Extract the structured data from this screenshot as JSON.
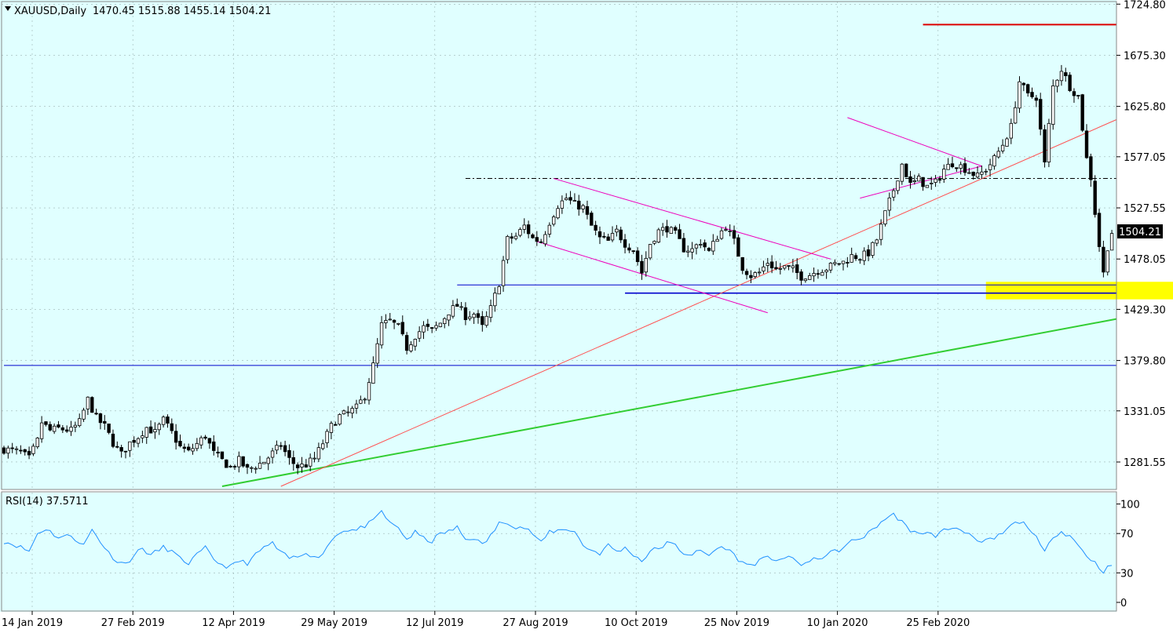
{
  "header": {
    "symbol": "XAUUSD,Daily",
    "ohlc": "1470.45 1515.88 1455.14 1504.21"
  },
  "rsi": {
    "label": "RSI(14) 37.5711"
  },
  "colors": {
    "background": "#e0ffff",
    "grid": "#9cb4b4",
    "candle_up": "#ffffff",
    "candle_down": "#000000",
    "support": "#0000cc",
    "trendline_green": "#32cd32",
    "trendline_red": "#ff5050",
    "resistance": "#dd0000",
    "pattern": "#ee00bb",
    "rsi_line": "#1e90ff",
    "highlight": "#ffff00"
  },
  "chart_data": [
    {
      "type": "candlestick",
      "title": "XAUUSD,Daily",
      "last_price": "1504.21",
      "ylim": [
        1258,
        1725
      ],
      "y_ticks": [
        "1724.80",
        "1675.30",
        "1625.80",
        "1577.05",
        "1527.55",
        "1478.05",
        "1429.30",
        "1379.80",
        "1331.05",
        "1281.55"
      ],
      "x_ticks": [
        "14 Jan 2019",
        "27 Feb 2019",
        "12 Apr 2019",
        "29 May 2019",
        "12 Jul 2019",
        "27 Aug 2019",
        "10 Oct 2019",
        "25 Nov 2019",
        "10 Jan 2020",
        "25 Feb 2020"
      ],
      "close_path": [
        [
          0,
          1294
        ],
        [
          4,
          1291
        ],
        [
          6,
          1285
        ],
        [
          8,
          1302
        ],
        [
          9,
          1320
        ],
        [
          11,
          1312
        ],
        [
          13,
          1314
        ],
        [
          16,
          1312
        ],
        [
          18,
          1320
        ],
        [
          20,
          1342
        ],
        [
          22,
          1324
        ],
        [
          24,
          1316
        ],
        [
          26,
          1300
        ],
        [
          28,
          1289
        ],
        [
          30,
          1300
        ],
        [
          32,
          1306
        ],
        [
          34,
          1315
        ],
        [
          36,
          1310
        ],
        [
          38,
          1322
        ],
        [
          40,
          1310
        ],
        [
          42,
          1296
        ],
        [
          44,
          1291
        ],
        [
          46,
          1299
        ],
        [
          48,
          1307
        ],
        [
          50,
          1290
        ],
        [
          52,
          1283
        ],
        [
          54,
          1276
        ],
        [
          56,
          1283
        ],
        [
          58,
          1274
        ],
        [
          60,
          1278
        ],
        [
          62,
          1282
        ],
        [
          64,
          1290
        ],
        [
          66,
          1298
        ],
        [
          68,
          1284
        ],
        [
          70,
          1277
        ],
        [
          72,
          1279
        ],
        [
          74,
          1285
        ],
        [
          76,
          1300
        ],
        [
          78,
          1316
        ],
        [
          80,
          1326
        ],
        [
          82,
          1329
        ],
        [
          84,
          1334
        ],
        [
          86,
          1346
        ],
        [
          88,
          1375
        ],
        [
          90,
          1414
        ],
        [
          92,
          1418
        ],
        [
          94,
          1412
        ],
        [
          96,
          1392
        ],
        [
          98,
          1404
        ],
        [
          100,
          1412
        ],
        [
          102,
          1409
        ],
        [
          104,
          1416
        ],
        [
          106,
          1427
        ],
        [
          108,
          1433
        ],
        [
          110,
          1423
        ],
        [
          112,
          1425
        ],
        [
          114,
          1412
        ],
        [
          116,
          1430
        ],
        [
          118,
          1455
        ],
        [
          120,
          1497
        ],
        [
          122,
          1500
        ],
        [
          124,
          1510
        ],
        [
          126,
          1498
        ],
        [
          128,
          1495
        ],
        [
          130,
          1514
        ],
        [
          132,
          1530
        ],
        [
          134,
          1537
        ],
        [
          136,
          1531
        ],
        [
          138,
          1528
        ],
        [
          140,
          1510
        ],
        [
          142,
          1498
        ],
        [
          144,
          1495
        ],
        [
          146,
          1505
        ],
        [
          148,
          1493
        ],
        [
          150,
          1487
        ],
        [
          152,
          1465
        ],
        [
          154,
          1493
        ],
        [
          156,
          1505
        ],
        [
          158,
          1508
        ],
        [
          160,
          1502
        ],
        [
          162,
          1488
        ],
        [
          164,
          1487
        ],
        [
          166,
          1495
        ],
        [
          168,
          1485
        ],
        [
          170,
          1500
        ],
        [
          172,
          1510
        ],
        [
          174,
          1495
        ],
        [
          176,
          1470
        ],
        [
          178,
          1462
        ],
        [
          180,
          1465
        ],
        [
          182,
          1475
        ],
        [
          184,
          1468
        ],
        [
          186,
          1470
        ],
        [
          188,
          1468
        ],
        [
          190,
          1461
        ],
        [
          192,
          1463
        ],
        [
          194,
          1467
        ],
        [
          196,
          1469
        ],
        [
          198,
          1473
        ],
        [
          200,
          1475
        ],
        [
          202,
          1481
        ],
        [
          204,
          1480
        ],
        [
          206,
          1484
        ],
        [
          208,
          1497
        ],
        [
          210,
          1522
        ],
        [
          212,
          1545
        ],
        [
          214,
          1570
        ],
        [
          216,
          1550
        ],
        [
          218,
          1555
        ],
        [
          220,
          1548
        ],
        [
          222,
          1552
        ],
        [
          224,
          1565
        ],
        [
          226,
          1571
        ],
        [
          228,
          1568
        ],
        [
          230,
          1563
        ],
        [
          232,
          1558
        ],
        [
          234,
          1565
        ],
        [
          236,
          1575
        ],
        [
          238,
          1589
        ],
        [
          240,
          1606
        ],
        [
          242,
          1650
        ],
        [
          244,
          1636
        ],
        [
          246,
          1635
        ],
        [
          248,
          1570
        ],
        [
          250,
          1645
        ],
        [
          252,
          1662
        ],
        [
          254,
          1645
        ],
        [
          256,
          1635
        ],
        [
          258,
          1575
        ],
        [
          259,
          1557
        ],
        [
          260,
          1523
        ],
        [
          261,
          1491
        ],
        [
          262,
          1464
        ],
        [
          263,
          1490
        ],
        [
          264,
          1504
        ]
      ],
      "overlays": [
        {
          "name": "support-1453",
          "kind": "horizontal",
          "price": 1453,
          "from": 108,
          "to": 280
        },
        {
          "name": "support-1445",
          "kind": "horizontal",
          "price": 1445,
          "from": 148,
          "to": 280
        },
        {
          "name": "support-1375",
          "kind": "horizontal",
          "price": 1375,
          "from": 0,
          "to": 280
        },
        {
          "name": "resistance-1705",
          "kind": "horizontal",
          "price": 1705,
          "from": 219,
          "to": 280
        },
        {
          "name": "neckline-1556",
          "kind": "horizontal-dashed",
          "price": 1556,
          "from": 110,
          "to": 280
        },
        {
          "name": "green-trendline",
          "kind": "trend",
          "points": [
            [
              52,
              1258
            ],
            [
              280,
              1420
            ]
          ]
        },
        {
          "name": "red-trendline",
          "kind": "trend",
          "points": [
            [
              66,
              1258
            ],
            [
              280,
              1613
            ]
          ]
        },
        {
          "name": "channel-upper",
          "kind": "pattern",
          "points": [
            [
              131,
              1556
            ],
            [
              197,
              1478
            ]
          ]
        },
        {
          "name": "channel-lower",
          "kind": "pattern",
          "points": [
            [
              127,
              1495
            ],
            [
              182,
              1426
            ]
          ]
        },
        {
          "name": "triangle-upper",
          "kind": "pattern",
          "points": [
            [
              201,
              1615
            ],
            [
              233,
              1568
            ]
          ]
        },
        {
          "name": "triangle-lower",
          "kind": "pattern",
          "points": [
            [
              204,
              1537
            ],
            [
              233,
              1568
            ]
          ]
        },
        {
          "name": "support-zone",
          "kind": "zone",
          "from": 234,
          "to": 279,
          "price_top": 1456,
          "price_bottom": 1439
        }
      ]
    },
    {
      "type": "line",
      "title": "RSI(14) 37.5711",
      "ylim": [
        -8,
        110
      ],
      "y_ticks": [
        "100",
        "70",
        "30",
        "0"
      ],
      "levels": [
        70,
        30
      ],
      "path": [
        [
          0,
          62
        ],
        [
          3,
          58
        ],
        [
          6,
          52
        ],
        [
          8,
          70
        ],
        [
          10,
          75
        ],
        [
          13,
          66
        ],
        [
          16,
          68
        ],
        [
          19,
          58
        ],
        [
          21,
          74
        ],
        [
          23,
          62
        ],
        [
          25,
          50
        ],
        [
          27,
          42
        ],
        [
          29,
          39
        ],
        [
          31,
          48
        ],
        [
          33,
          55
        ],
        [
          35,
          48
        ],
        [
          38,
          56
        ],
        [
          40,
          52
        ],
        [
          42,
          44
        ],
        [
          44,
          40
        ],
        [
          46,
          48
        ],
        [
          48,
          55
        ],
        [
          50,
          44
        ],
        [
          52,
          38
        ],
        [
          54,
          36
        ],
        [
          56,
          42
        ],
        [
          58,
          40
        ],
        [
          60,
          48
        ],
        [
          62,
          56
        ],
        [
          64,
          60
        ],
        [
          66,
          50
        ],
        [
          68,
          45
        ],
        [
          70,
          46
        ],
        [
          72,
          52
        ],
        [
          74,
          45
        ],
        [
          76,
          50
        ],
        [
          78,
          63
        ],
        [
          80,
          72
        ],
        [
          82,
          74
        ],
        [
          84,
          73
        ],
        [
          86,
          78
        ],
        [
          88,
          82
        ],
        [
          90,
          93
        ],
        [
          92,
          80
        ],
        [
          94,
          76
        ],
        [
          96,
          64
        ],
        [
          98,
          71
        ],
        [
          100,
          65
        ],
        [
          102,
          62
        ],
        [
          104,
          70
        ],
        [
          106,
          72
        ],
        [
          108,
          76
        ],
        [
          110,
          64
        ],
        [
          112,
          66
        ],
        [
          114,
          58
        ],
        [
          116,
          68
        ],
        [
          118,
          80
        ],
        [
          120,
          82
        ],
        [
          122,
          77
        ],
        [
          124,
          76
        ],
        [
          126,
          70
        ],
        [
          128,
          60
        ],
        [
          130,
          72
        ],
        [
          132,
          73
        ],
        [
          134,
          75
        ],
        [
          136,
          72
        ],
        [
          138,
          58
        ],
        [
          140,
          53
        ],
        [
          142,
          50
        ],
        [
          144,
          58
        ],
        [
          146,
          52
        ],
        [
          148,
          55
        ],
        [
          150,
          49
        ],
        [
          152,
          42
        ],
        [
          154,
          52
        ],
        [
          156,
          55
        ],
        [
          158,
          60
        ],
        [
          160,
          58
        ],
        [
          162,
          50
        ],
        [
          164,
          49
        ],
        [
          166,
          52
        ],
        [
          168,
          48
        ],
        [
          170,
          55
        ],
        [
          172,
          56
        ],
        [
          174,
          48
        ],
        [
          176,
          40
        ],
        [
          178,
          38
        ],
        [
          180,
          42
        ],
        [
          182,
          45
        ],
        [
          184,
          44
        ],
        [
          186,
          45
        ],
        [
          188,
          44
        ],
        [
          190,
          39
        ],
        [
          192,
          41
        ],
        [
          194,
          45
        ],
        [
          196,
          48
        ],
        [
          198,
          52
        ],
        [
          200,
          55
        ],
        [
          202,
          62
        ],
        [
          204,
          65
        ],
        [
          206,
          70
        ],
        [
          208,
          78
        ],
        [
          210,
          85
        ],
        [
          212,
          89
        ],
        [
          214,
          83
        ],
        [
          216,
          70
        ],
        [
          218,
          72
        ],
        [
          220,
          70
        ],
        [
          222,
          68
        ],
        [
          224,
          73
        ],
        [
          226,
          76
        ],
        [
          228,
          75
        ],
        [
          230,
          70
        ],
        [
          232,
          60
        ],
        [
          234,
          62
        ],
        [
          236,
          65
        ],
        [
          238,
          70
        ],
        [
          240,
          78
        ],
        [
          242,
          82
        ],
        [
          244,
          78
        ],
        [
          246,
          65
        ],
        [
          248,
          50
        ],
        [
          250,
          68
        ],
        [
          252,
          72
        ],
        [
          254,
          68
        ],
        [
          256,
          58
        ],
        [
          258,
          48
        ],
        [
          260,
          40
        ],
        [
          262,
          32
        ],
        [
          264,
          38
        ]
      ]
    }
  ]
}
